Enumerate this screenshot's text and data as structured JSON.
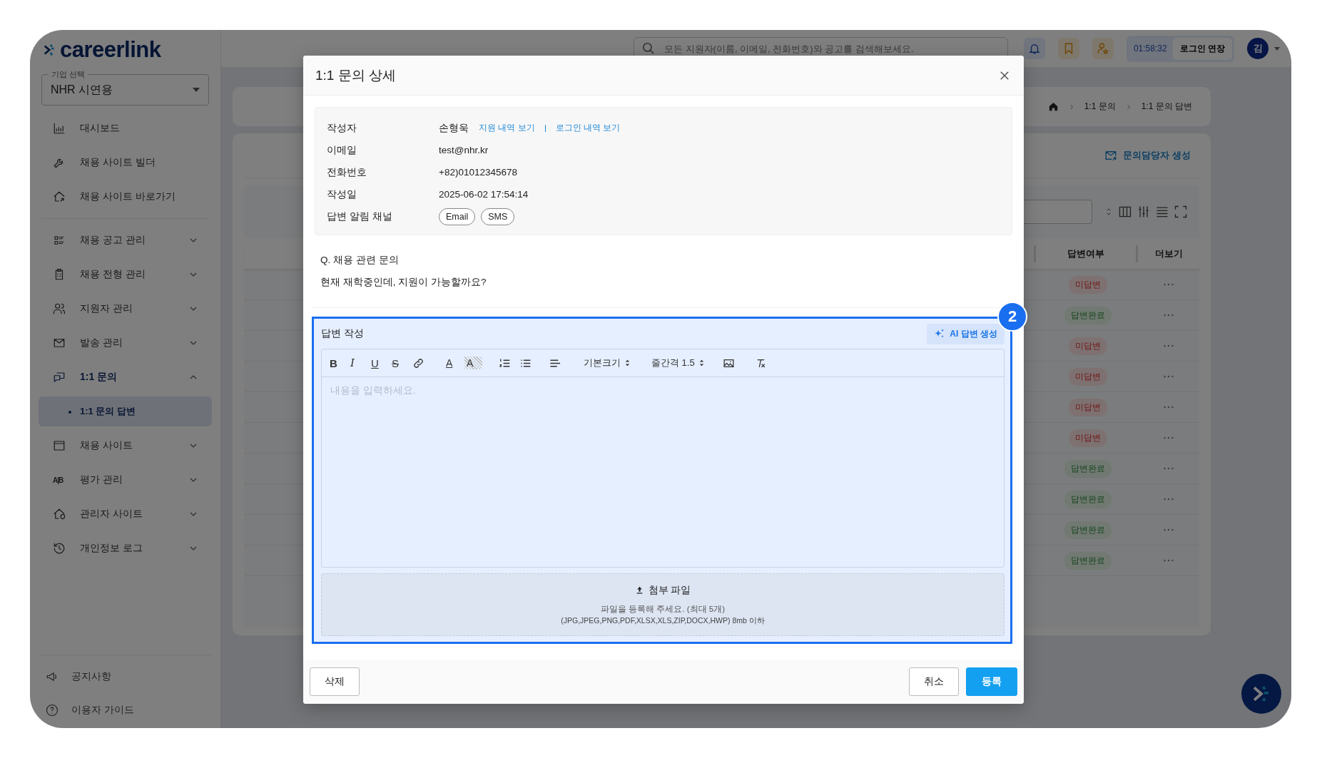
{
  "app": {
    "logo": "careerlink",
    "company_select": {
      "label": "기업 선택",
      "value": "NHR 시연용"
    }
  },
  "sidebar": {
    "groups": [
      [
        {
          "label": "대시보드",
          "selected": false
        },
        {
          "label": "채용 사이트 빌더",
          "selected": false
        },
        {
          "label": "채용 사이트 바로가기",
          "selected": false
        }
      ],
      [
        {
          "label": "채용 공고 관리",
          "selected": false,
          "expanded": false
        },
        {
          "label": "채용 전형 관리",
          "selected": false,
          "expanded": false
        },
        {
          "label": "지원자 관리",
          "selected": false,
          "expanded": false
        },
        {
          "label": "발송 관리",
          "selected": false,
          "expanded": false
        },
        {
          "label": "1:1 문의",
          "selected": true,
          "expanded": true,
          "children": [
            {
              "label": "1:1 문의 답변",
              "selected": true
            }
          ]
        },
        {
          "label": "채용 사이트",
          "selected": false,
          "expanded": false
        },
        {
          "label": "평가 관리",
          "selected": false,
          "expanded": false,
          "glyph": "A|B"
        },
        {
          "label": "관리자 사이트",
          "selected": false,
          "expanded": false
        },
        {
          "label": "개인정보 로그",
          "selected": false,
          "expanded": false
        }
      ]
    ],
    "footer": [
      {
        "label": "공지사항"
      },
      {
        "label": "이용자 가이드"
      }
    ]
  },
  "header": {
    "search": {
      "placeholder": "모든 지원자(이름, 이메일, 전화번호)와 공고를 검색해보세요."
    },
    "timer": "01:58:32",
    "extend_button": "로그인 연장",
    "avatar": "김"
  },
  "breadcrumb": [
    "1:1 문의",
    "1:1 문의 답변"
  ],
  "page": {
    "create_button": "문의담당자 생성",
    "table": {
      "columns": [
        "답변여부",
        "더보기"
      ],
      "rows": [
        {
          "status": "미답변",
          "answered": false
        },
        {
          "status": "답변완료",
          "answered": true
        },
        {
          "status": "미답변",
          "answered": false
        },
        {
          "status": "미답변",
          "answered": false
        },
        {
          "status": "미답변",
          "answered": false
        },
        {
          "status": "미답변",
          "answered": false
        },
        {
          "status": "답변완료",
          "answered": true
        },
        {
          "status": "답변완료",
          "answered": true
        },
        {
          "status": "답변완료",
          "answered": true
        },
        {
          "status": "답변완료",
          "answered": true
        }
      ]
    }
  },
  "modal": {
    "title": "1:1 문의 상세",
    "info": [
      {
        "label": "작성자",
        "value": "손형욱",
        "links": [
          "지원 내역 보기",
          "로그인 내역 보기"
        ]
      },
      {
        "label": "이메일",
        "value": "test@nhr.kr"
      },
      {
        "label": "전화번호",
        "value": "+82)01012345678"
      },
      {
        "label": "작성일",
        "value": "2025-06-02 17:54:14"
      },
      {
        "label": "답변 알림 채널",
        "chips": [
          "Email",
          "SMS"
        ]
      }
    ],
    "question": {
      "title": "Q. 채용 관련 문의",
      "body": "현재 재학중인데, 지원이 가능할까요?"
    },
    "answer": {
      "label": "답변 작성",
      "ai_button": "AI 답변 생성",
      "highlighted": true,
      "step": "2",
      "toolbar": [
        {
          "kind": "bold",
          "label": "B"
        },
        {
          "kind": "italic",
          "label": "I"
        },
        {
          "kind": "underline",
          "label": "U"
        },
        {
          "kind": "strike",
          "label": "S"
        },
        {
          "kind": "link"
        },
        {
          "kind": "color",
          "label": "A"
        },
        {
          "kind": "highlight",
          "label": "A"
        },
        {
          "kind": "ordered"
        },
        {
          "kind": "bullet"
        },
        {
          "kind": "align"
        },
        {
          "kind": "select",
          "label": "기본크기"
        },
        {
          "kind": "select",
          "label": "줄간격 1.5"
        },
        {
          "kind": "image"
        },
        {
          "kind": "clear"
        }
      ],
      "editor": {
        "placeholder": "내용을 입력하세요."
      },
      "attachment": {
        "title": "첨부 파일",
        "hint": "파일을 등록해 주세요. (최대 5개)",
        "formats": "(JPG,JPEG,PNG,PDF,XLSX,XLS,ZIP,DOCX,HWP) 8mb 이하"
      }
    },
    "buttons": {
      "delete": "삭제",
      "cancel": "취소",
      "submit": "등록"
    }
  }
}
